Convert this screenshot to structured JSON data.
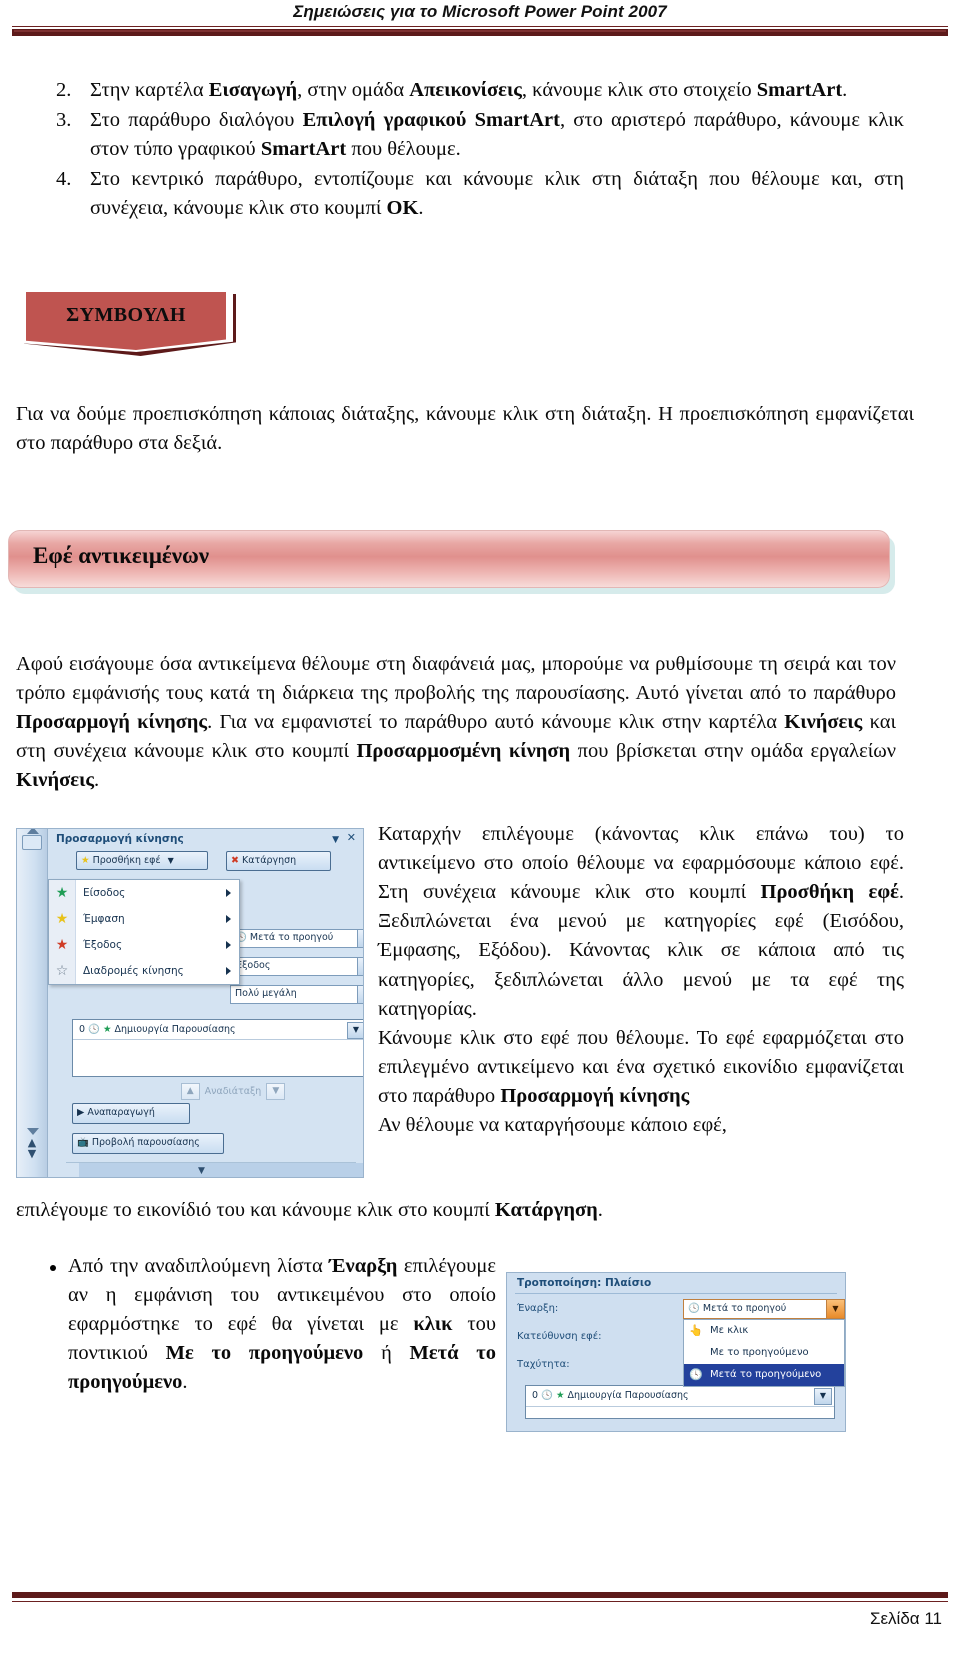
{
  "header": {
    "title": "Σημειώσεις για το Microsoft Power Point 2007"
  },
  "numbered_list": [
    {
      "num": "2.",
      "html": "Στην καρτέλα <b>Εισαγωγή</b>, στην ομάδα <b>Απεικονίσεις</b>, κάνουμε κλικ στο στοιχείο <b>SmartArt</b>."
    },
    {
      "num": "3.",
      "html": "Στο παράθυρο διαλόγου <b>Επιλογή γραφικού SmartArt</b>, στο αριστερό παράθυρο, κάνουμε κλικ στον τύπο γραφικού <b>SmartArt</b> που θέλουμε."
    },
    {
      "num": "4.",
      "html": "Στο κεντρικό παράθυρο, εντοπίζουμε και κάνουμε κλικ στη διάταξη που θέλουμε και, στη συνέχεια, κάνουμε κλικ στο κουμπί <b>OK</b>."
    }
  ],
  "tip": {
    "label": "ΣΥΜΒΟΥΛΗ",
    "text": "Για να δούμε προεπισκόπηση κάποιας διάταξης, κάνουμε κλικ στη διάταξη. Η προεπισκόπηση εμφανίζεται στο παράθυρο στα δεξιά.",
    "banner_color": "#bf5450",
    "shadow_color": "#5d1a1a"
  },
  "section": {
    "heading": "Εφέ αντικειμένων",
    "bar_gradient_top": "#f6d4d4",
    "bar_gradient_mid": "#e0908d",
    "bar_shadow": "#b5dbdb"
  },
  "paragraphs": {
    "intro_html": "Αφού εισάγουμε όσα αντικείμενα θέλουμε στη διαφάνειά μας, μπορούμε να ρυθμίσουμε τη σειρά και τον τρόπο εμφάνισής τους κατά τη διάρκεια της προβολής της παρουσίασης. Αυτό γίνεται από το παράθυρο <b>Προσαρμογή κίνησης</b>. Για να εμφανιστεί το παράθυρο αυτό κάνουμε κλικ στην καρτέλα <b>Κινήσεις</b> και στη συνέχεια κάνουμε κλικ στο κουμπί <b>Προσαρμοσμένη κίνηση</b> που βρίσκεται στην ομάδα εργαλείων <b>Κινήσεις</b>.",
    "flow_html": "Καταρχήν επιλέγουμε (κάνοντας κλικ επάνω του) το αντικείμενο στο οποίο θέλουμε να εφαρμόσουμε κάποιο εφέ. Στη συνέχεια κάνουμε κλικ στο κουμπί <b>Προσθήκη εφέ</b>. Ξεδιπλώνεται ένα μενού με κατηγορίες εφέ (Εισόδου, Έμφασης, Εξόδου). Κάνοντας κλικ σε κάποια από τις κατηγορίες, ξεδιπλώνεται άλλο μενού με τα εφέ της κατηγορίας.<br>Κάνουμε κλικ στο εφέ που θέλουμε. Το εφέ εφαρμόζεται στο επιλεγμένο αντικείμενο και ένα σχετικό εικονίδιο εμφανίζεται στο παράθυρο <b>Προσαρμογή κίνησης</b><br>Αν θέλουμε να καταργήσουμε κάποιο εφέ,",
    "after_float_html": "επιλέγουμε το εικονίδιό του και κάνουμε κλικ στο κουμπί <b>Κατάργηση</b>."
  },
  "bullet": {
    "html": "Από την αναδιπλούμενη λίστα <b>Έναρξη</b> επιλέγουμε αν η εμφάνιση του αντικειμένου στο οποίο εφαρμόστηκε το εφέ θα γίνεται με <b>κλικ</b> του ποντικιού <b>Με το προηγούμενο</b> ή <b>Μετά το προηγούμενο</b>."
  },
  "screenshot1": {
    "pane_title": "Προσαρμογή κίνησης",
    "add_effect_button": "Προσθήκη εφέ",
    "remove_button": "Κατάργηση",
    "menu_items": [
      {
        "label": "Είσοδος",
        "icon": "green-star-icon"
      },
      {
        "label": "Έμφαση",
        "icon": "yellow-star-icon"
      },
      {
        "label": "Έξοδος",
        "icon": "red-star-icon"
      },
      {
        "label": "Διαδρομές κίνησης",
        "icon": "outline-star-icon"
      }
    ],
    "fields": [
      {
        "value": "Μετά το προηγού"
      },
      {
        "value": "Έξοδος"
      },
      {
        "value": "Πολύ μεγάλη"
      }
    ],
    "list_row": {
      "index": "0",
      "label": "Δημιουργία Παρουσίασης"
    },
    "reorder_label": "Αναδιάταξη",
    "play_button": "Αναπαραγωγή",
    "slideshow_button": "Προβολή παρουσίασης"
  },
  "screenshot2": {
    "title": "Τροποποίηση: Πλαίσιο",
    "labels": [
      "Έναρξη:",
      "Κατεύθυνση εφέ:",
      "Ταχύτητα:"
    ],
    "combo_value": "Μετά το προηγού",
    "dropdown_items": [
      {
        "label": "Με κλικ",
        "selected": false,
        "icon": "mouse-click-icon"
      },
      {
        "label": "Με το προηγούμενο",
        "selected": false,
        "icon": ""
      },
      {
        "label": "Μετά το προηγούμενο",
        "selected": true,
        "icon": "clock-icon"
      }
    ],
    "list_row": {
      "index": "0",
      "label": "Δημιουργία Παρουσίασης"
    }
  },
  "footer": {
    "page": "Σελίδα 11",
    "rule_color": "#5d1a1a"
  }
}
